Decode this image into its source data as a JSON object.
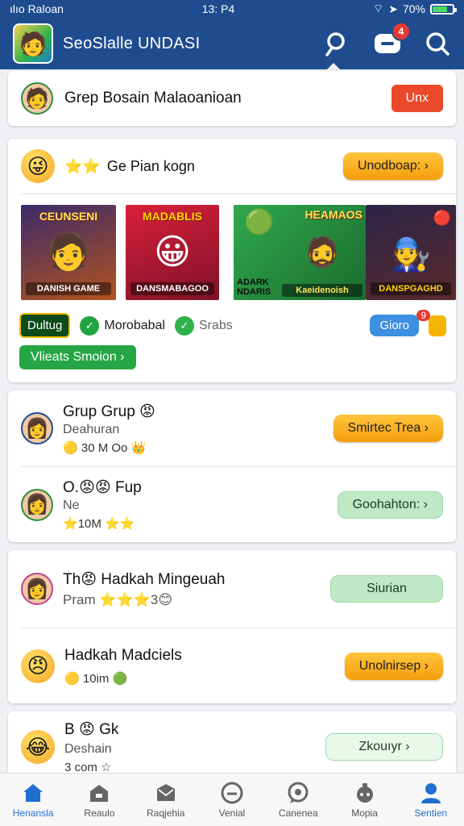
{
  "status_bar": {
    "carrier": "ılıo Raloan",
    "time": "13: P4",
    "battery": "70%"
  },
  "app": {
    "title": "SeoSlalle UNDASI",
    "notification_count": "4"
  },
  "top_card": {
    "name": "Grep Bosain Malaoanioan",
    "button": "Unx"
  },
  "feature_card": {
    "title": "Ge Pian kogn",
    "button": "Unodboap: ›",
    "banners": [
      {
        "top": "CEUNSENI",
        "bottom": "DANISH GAME",
        "figure": "🧑"
      },
      {
        "top": "MADABLIS",
        "bottom": "DANSMABAGOO",
        "figure": "😀"
      },
      {
        "top": "HEAMAOS",
        "bottom": "Kaeidenoish",
        "extra": "ADARK NDARIS",
        "figure": "🧔"
      },
      {
        "top": "",
        "bottom": "DANSPGAGHD",
        "figure": "🧑‍🔧"
      }
    ],
    "chips": [
      "Dultug",
      "Morobabal",
      "Srabs"
    ],
    "pill": "Gioro",
    "pill_badge": "9",
    "cta": "Vlieats Smoion  ›"
  },
  "list_a": [
    {
      "name": "Grup Grup",
      "sub": "Deahuran",
      "meta": "30 M Oo",
      "button": "Smirtec Trea ›",
      "button_style": "orange"
    },
    {
      "name": "O.",
      "name_tail": "Fup",
      "sub": "Ne",
      "meta": "10M",
      "button": "Goohahton: ›",
      "button_style": "green"
    }
  ],
  "list_b": [
    {
      "name": "Th",
      "name_tail": "Hadkah Mingeuah",
      "sub": "Pram",
      "meta": "3",
      "button": "Siurian",
      "button_style": "green"
    },
    {
      "name": "Hadkah Madciels",
      "sub": "",
      "meta": "10im",
      "button": "Unolnirsep ›",
      "button_style": "orange"
    }
  ],
  "list_c": [
    {
      "name": "B",
      "name_tail": "Gk",
      "sub": "Deshain",
      "meta": "3 com",
      "button": "Zkouıyr",
      "button_style": "outline"
    }
  ],
  "bottom_nav": [
    {
      "label": "Henansla",
      "icon": "home-icon"
    },
    {
      "label": "Reaulo",
      "icon": "store-icon"
    },
    {
      "label": "Raqjehia",
      "icon": "mail-icon"
    },
    {
      "label": "Venial",
      "icon": "clock-icon"
    },
    {
      "label": "Canenea",
      "icon": "chat-icon"
    },
    {
      "label": "Mopia",
      "icon": "gamepad-icon"
    },
    {
      "label": "Sentien",
      "icon": "profile-icon"
    }
  ],
  "colors": {
    "primary": "#1f4c8f",
    "accent_orange": "#f59e0b",
    "accent_green": "#23a443",
    "danger": "#ea4a2a",
    "active_nav": "#1f6fd1"
  }
}
